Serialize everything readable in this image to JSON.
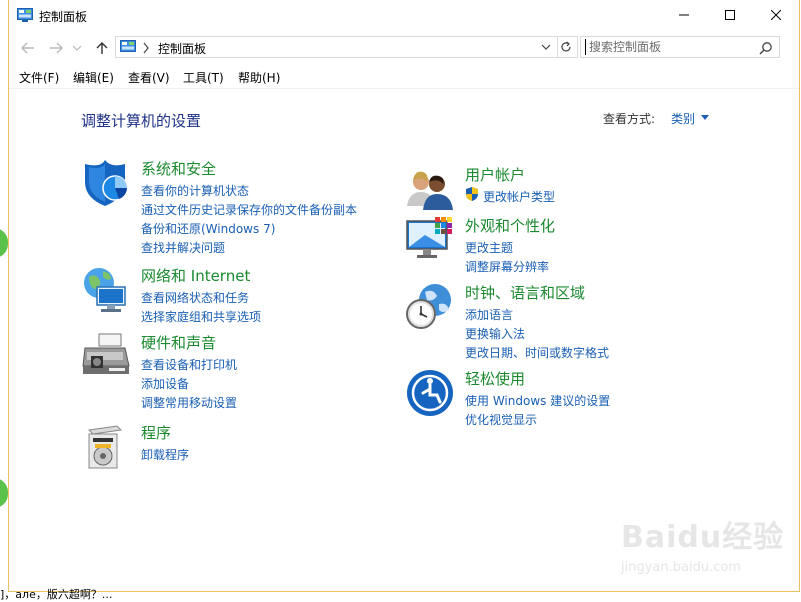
{
  "window": {
    "title": "控制面板"
  },
  "nav": {
    "address_text": "控制面板",
    "search_placeholder": "搜索控制面板"
  },
  "menu": [
    {
      "label": "文件(F)"
    },
    {
      "label": "编辑(E)"
    },
    {
      "label": "查看(V)"
    },
    {
      "label": "工具(T)"
    },
    {
      "label": "帮助(H)"
    }
  ],
  "content": {
    "page_title": "调整计算机的设置",
    "view_label": "查看方式:",
    "view_value": "类别",
    "categories": [
      {
        "icon": "system-security-icon",
        "title": "系统和安全",
        "links": [
          "查看你的计算机状态",
          "通过文件历史记录保存你的文件备份副本",
          "备份和还原(Windows 7)",
          "查找并解决问题"
        ]
      },
      {
        "icon": "network-internet-icon",
        "title": "网络和 Internet",
        "links": [
          "查看网络状态和任务",
          "选择家庭组和共享选项"
        ]
      },
      {
        "icon": "hardware-sound-icon",
        "title": "硬件和声音",
        "links": [
          "查看设备和打印机",
          "添加设备",
          "调整常用移动设置"
        ]
      },
      {
        "icon": "programs-icon",
        "title": "程序",
        "links": [
          "卸载程序"
        ]
      },
      {
        "icon": "user-accounts-icon",
        "title": "用户帐户",
        "links": [
          "更改帐户类型"
        ]
      },
      {
        "icon": "appearance-icon",
        "title": "外观和个性化",
        "links": [
          "更改主题",
          "调整屏幕分辨率"
        ]
      },
      {
        "icon": "clock-region-icon",
        "title": "时钟、语言和区域",
        "links": [
          "添加语言",
          "更换输入法",
          "更改日期、时间或数字格式"
        ]
      },
      {
        "icon": "ease-of-access-icon",
        "title": "轻松使用",
        "links": [
          "使用 Windows 建议的设置",
          "优化视觉显示"
        ]
      }
    ]
  },
  "overlay": {
    "watermark": "Baidu经验",
    "watermark_url": "jingyan.baidu.com",
    "bottom_text": "]，але，版六超啊？..."
  },
  "colors": {
    "category_title": "#1b8a2f",
    "link": "#1a5fb4",
    "page_title": "#1e3287"
  }
}
